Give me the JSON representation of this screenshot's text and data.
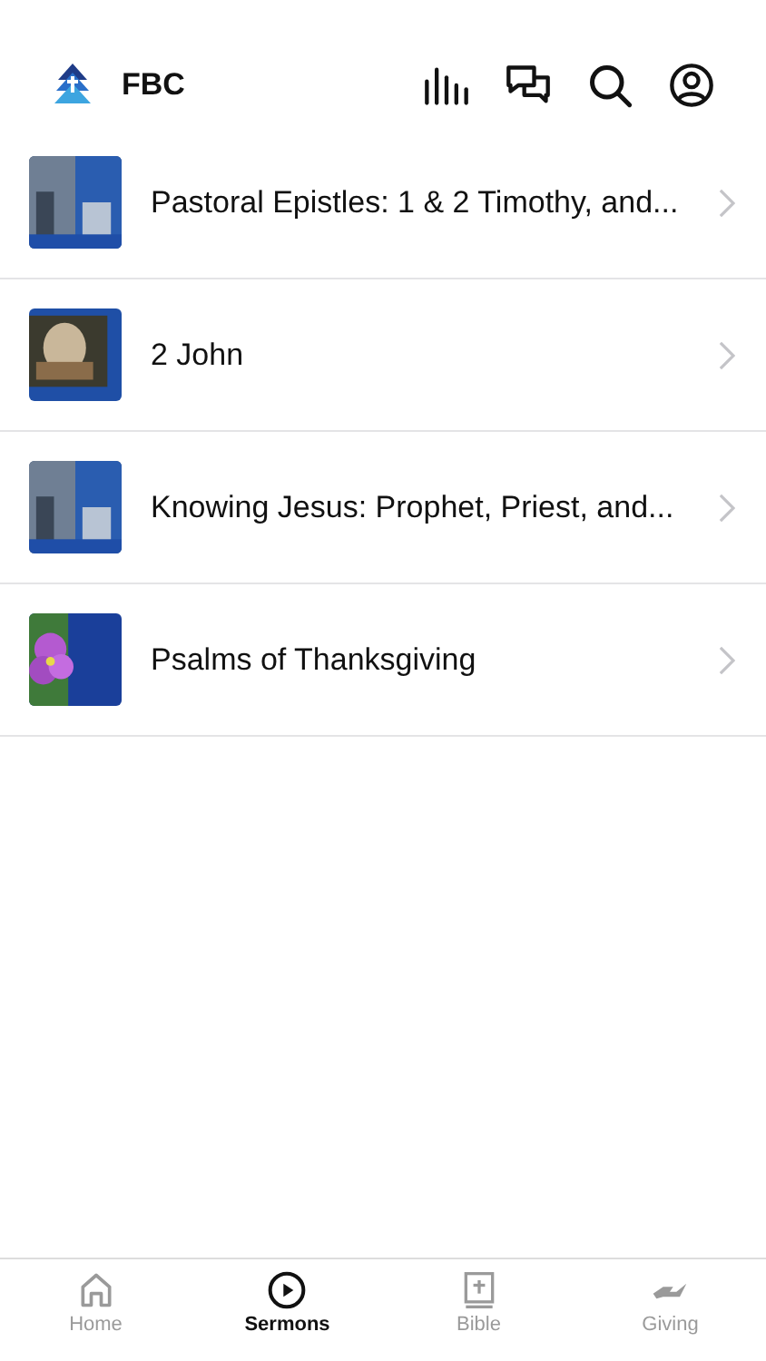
{
  "header": {
    "title": "FBC"
  },
  "sermons": [
    {
      "title": "Pastoral Epistles: 1 & 2 Timothy, and..."
    },
    {
      "title": "2 John"
    },
    {
      "title": "Knowing Jesus: Prophet, Priest, and..."
    },
    {
      "title": "Psalms of Thanksgiving"
    }
  ],
  "tab_bar": [
    {
      "label": "Home",
      "kind": "home",
      "selected": false
    },
    {
      "label": "Sermons",
      "kind": "play",
      "selected": true
    },
    {
      "label": "Bible",
      "kind": "bible",
      "selected": false
    },
    {
      "label": "Giving",
      "kind": "hand",
      "selected": false
    }
  ]
}
